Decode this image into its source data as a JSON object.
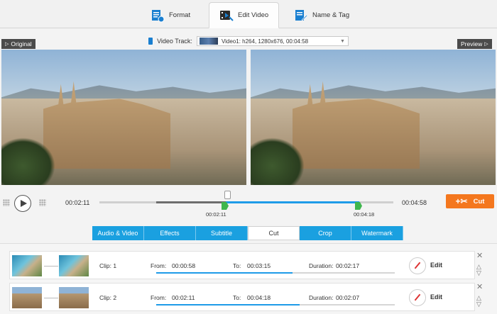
{
  "top_tabs": [
    {
      "label": "Format",
      "icon": "format-icon"
    },
    {
      "label": "Edit Video",
      "icon": "edit-video-icon"
    },
    {
      "label": "Name & Tag",
      "icon": "name-tag-icon"
    }
  ],
  "video_track": {
    "label": "Video Track:",
    "value": "Video1: h264, 1280x676, 00:04:58"
  },
  "original_label": "Original",
  "preview_label": "Preview",
  "transport": {
    "current_time": "00:02:11",
    "end_time": "00:04:58",
    "marker_start": "00:02:11",
    "marker_end": "00:04:18",
    "cut_label": "Cut"
  },
  "edit_tabs": [
    "Audio & Video",
    "Effects",
    "Subtitle",
    "Cut",
    "Crop",
    "Watermark"
  ],
  "active_edit_tab": "Cut",
  "clips": [
    {
      "clip": "Clip: 1",
      "from_label": "From:",
      "from": "00:00:58",
      "to_label": "To:",
      "to": "00:03:15",
      "duration_label": "Duration:",
      "duration": "00:02:17",
      "edit": "Edit",
      "progress": 0.57
    },
    {
      "clip": "Clip: 2",
      "from_label": "From:",
      "from": "00:02:11",
      "to_label": "To:",
      "to": "00:04:18",
      "duration_label": "Duration:",
      "duration": "00:02:07",
      "edit": "Edit",
      "progress": 0.6
    }
  ],
  "colors": {
    "accent_blue": "#1aa0e0",
    "cut_orange": "#f4771e",
    "marker_green": "#3fb64d"
  }
}
